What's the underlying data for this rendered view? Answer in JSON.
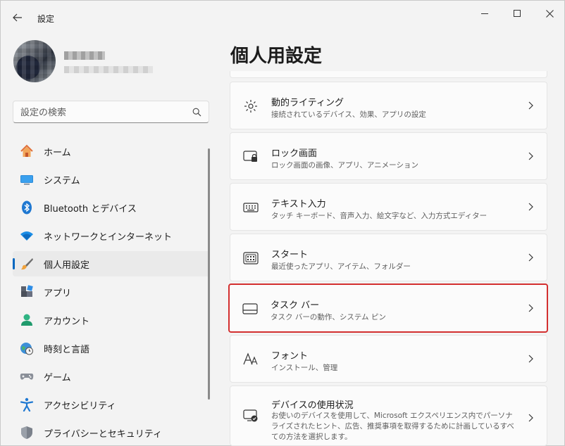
{
  "window": {
    "title": "設定"
  },
  "search": {
    "placeholder": "設定の検索"
  },
  "page": {
    "title": "個人用設定"
  },
  "nav": {
    "items": [
      {
        "label": "ホーム",
        "icon": "home-icon"
      },
      {
        "label": "システム",
        "icon": "monitor-icon"
      },
      {
        "label": "Bluetooth とデバイス",
        "icon": "bluetooth-icon"
      },
      {
        "label": "ネットワークとインターネット",
        "icon": "wifi-icon"
      },
      {
        "label": "個人用設定",
        "icon": "brush-icon",
        "active": true
      },
      {
        "label": "アプリ",
        "icon": "apps-icon"
      },
      {
        "label": "アカウント",
        "icon": "person-icon"
      },
      {
        "label": "時刻と言語",
        "icon": "globe-clock-icon"
      },
      {
        "label": "ゲーム",
        "icon": "gamepad-icon"
      },
      {
        "label": "アクセシビリティ",
        "icon": "accessibility-icon"
      },
      {
        "label": "プライバシーとセキュリティ",
        "icon": "shield-icon"
      }
    ]
  },
  "cards": [
    {
      "title": "動的ライティング",
      "desc": "接続されているデバイス、効果、アプリの設定",
      "icon": "dynamic-lighting-icon"
    },
    {
      "title": "ロック画面",
      "desc": "ロック画面の画像、アプリ、アニメーション",
      "icon": "lock-screen-icon"
    },
    {
      "title": "テキスト入力",
      "desc": "タッチ キーボード、音声入力、絵文字など、入力方式エディター",
      "icon": "keyboard-icon"
    },
    {
      "title": "スタート",
      "desc": "最近使ったアプリ、アイテム、フォルダー",
      "icon": "start-icon"
    },
    {
      "title": "タスク バー",
      "desc": "タスク バーの動作、システム ピン",
      "icon": "taskbar-icon",
      "highlighted": true
    },
    {
      "title": "フォント",
      "desc": "インストール、管理",
      "icon": "fonts-icon"
    },
    {
      "title": "デバイスの使用状況",
      "desc": "お使いのデバイスを使用して、Microsoft エクスペリエンス内でパーソナライズされたヒント、広告、推奨事項を取得するために計画しているすべての方法を選択します。",
      "icon": "device-usage-icon"
    }
  ],
  "colors": {
    "accent": "#0067c0",
    "highlight": "#d32f2f"
  }
}
